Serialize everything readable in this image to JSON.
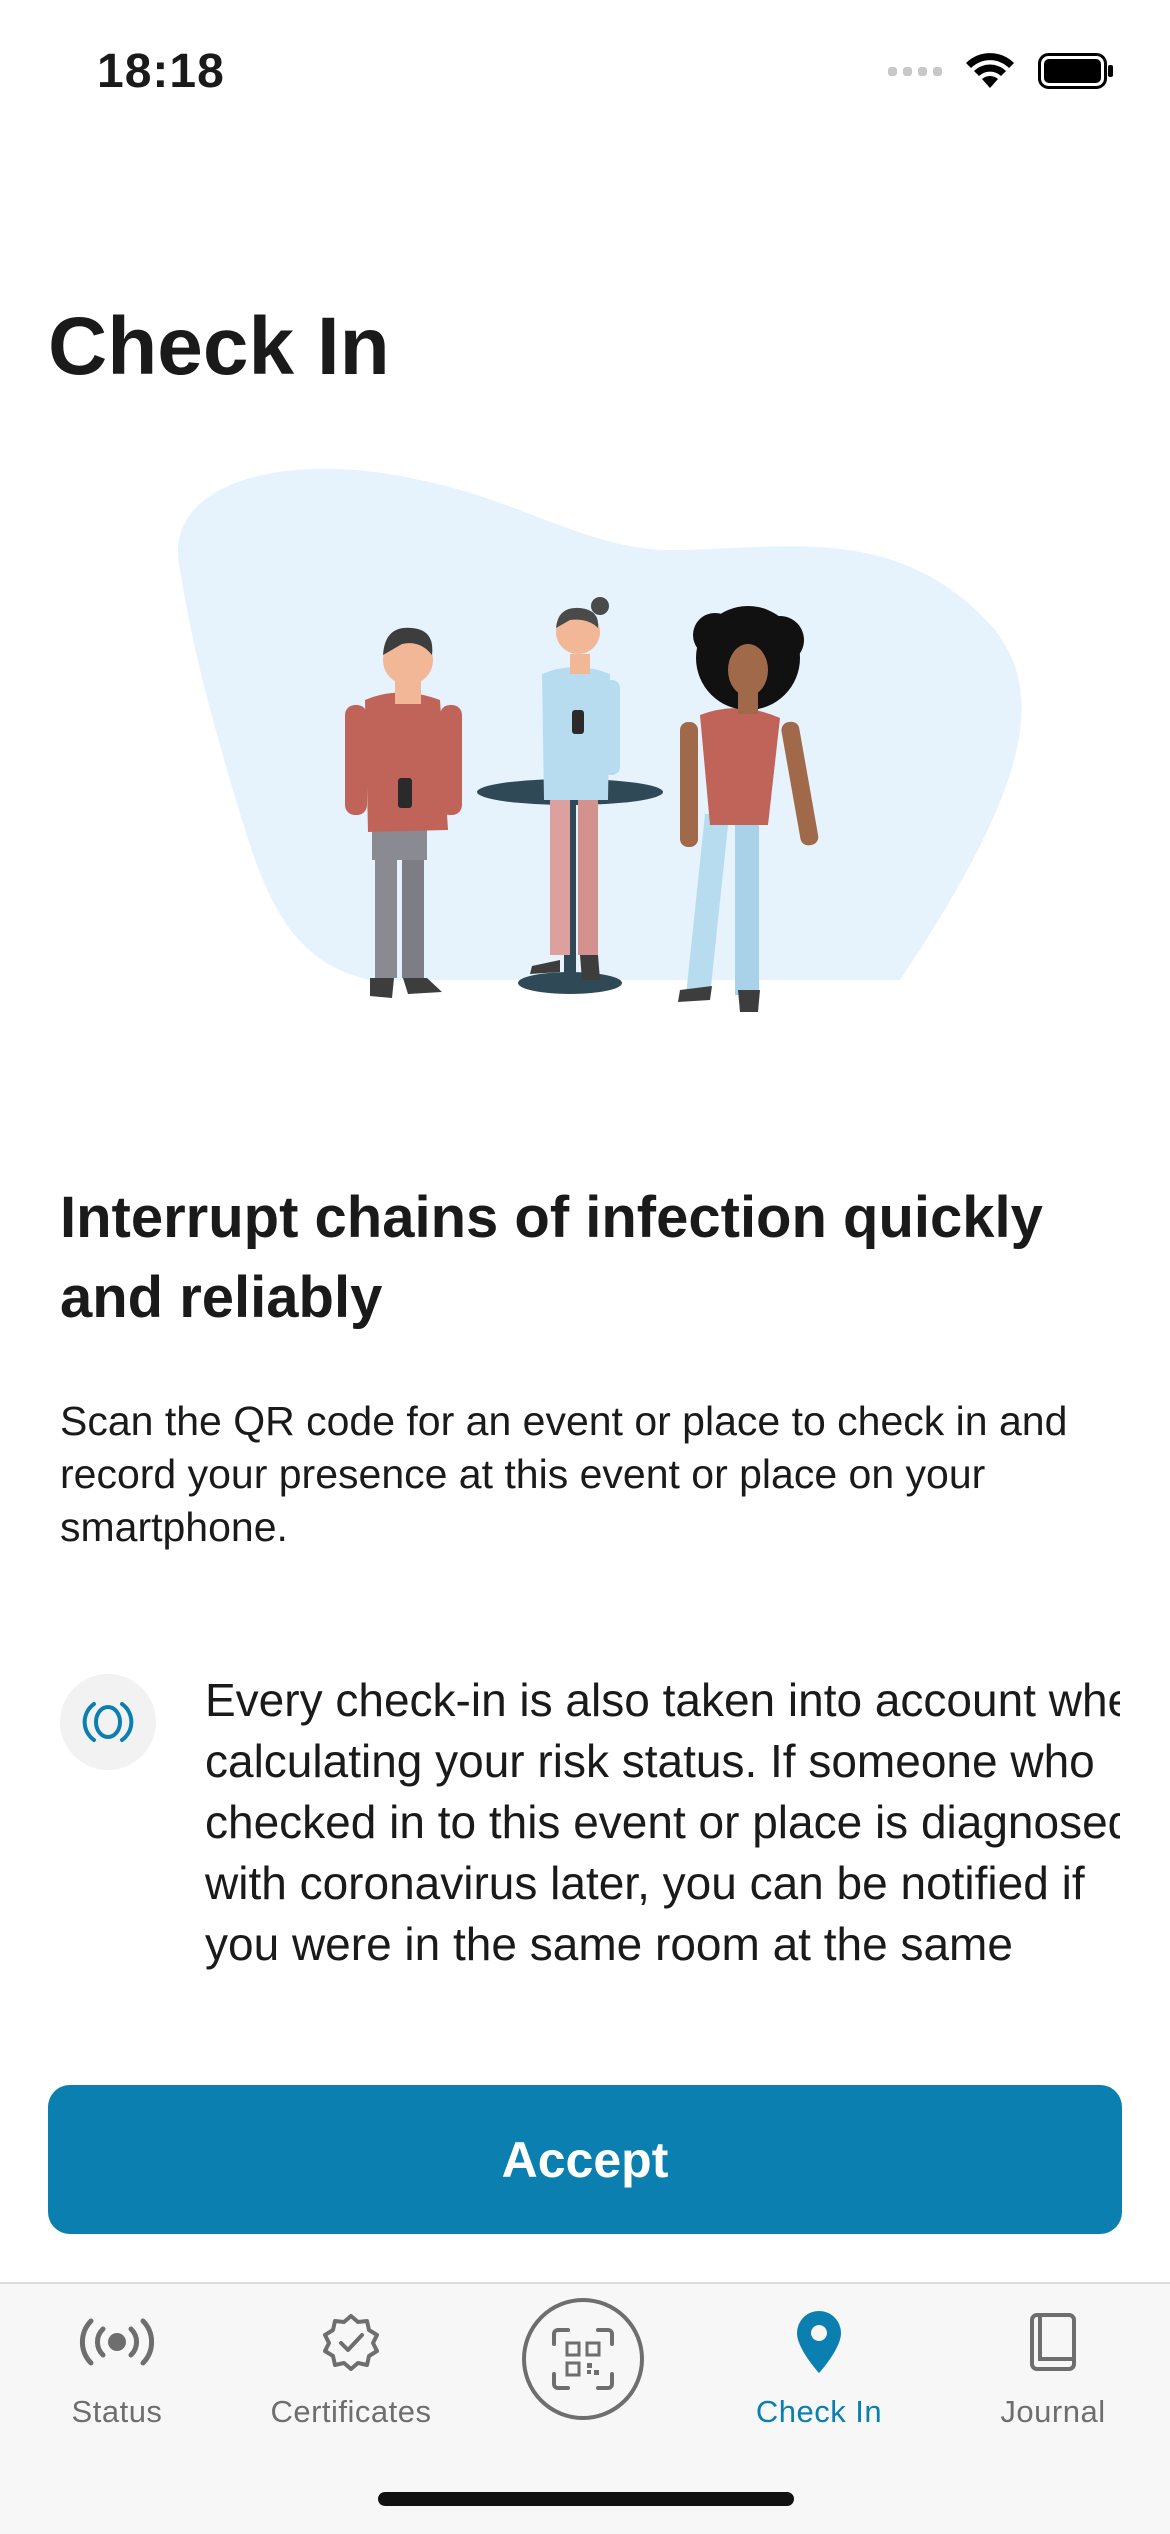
{
  "status_bar": {
    "time": "18:18"
  },
  "page": {
    "title": "Check In",
    "headline": "Interrupt chains of infection quickly and reliably",
    "intro": "Scan the QR code for an event or place to check in and record your presence at this event or place on your smartphone.",
    "info_text": "Every check-in is also taken into account when calculating your risk status. If someone who checked in to this event or place is diagnosed with coronavirus later, you can be notified if you were in the same room at the same",
    "info_icon": "risk-radar-icon"
  },
  "actions": {
    "accept_label": "Accept"
  },
  "tab_bar": {
    "tabs": [
      {
        "label": "Status",
        "icon": "broadcast-icon",
        "active": false
      },
      {
        "label": "Certificates",
        "icon": "certificate-badge-icon",
        "active": false
      },
      {
        "label": "",
        "icon": "qr-scan-icon",
        "active": false
      },
      {
        "label": "Check In",
        "icon": "location-pin-icon",
        "active": true
      },
      {
        "label": "Journal",
        "icon": "journal-book-icon",
        "active": false
      }
    ]
  },
  "colors": {
    "accent": "#0a7fb0",
    "blob": "#e6f3fd",
    "text": "#1a1a1a",
    "tab_inactive": "#6e6e6e"
  }
}
